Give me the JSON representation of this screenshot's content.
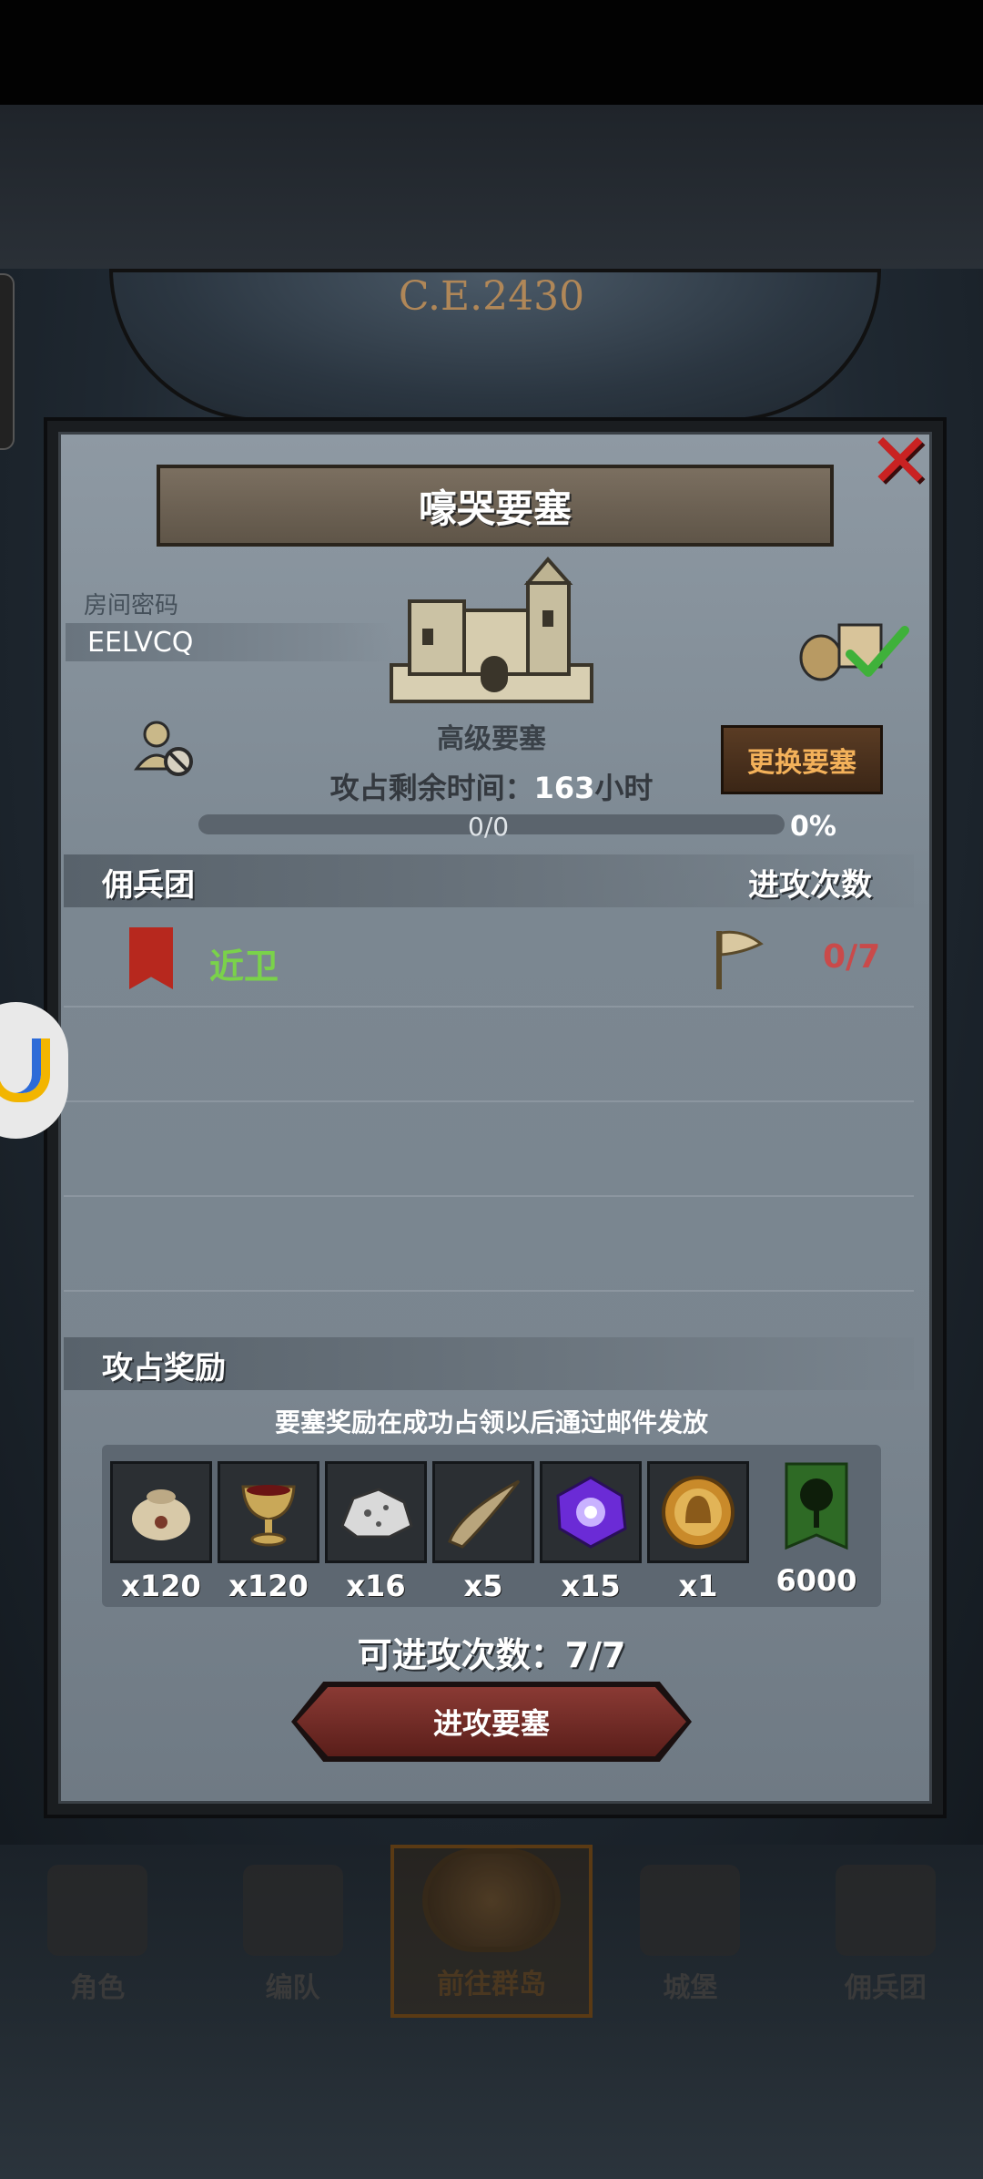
{
  "era": "C.E.2430",
  "popup": {
    "title": "嚎哭要塞",
    "close_icon": "close-x-icon",
    "room_code_label": "房间密码",
    "room_code": "EELVCQ",
    "fortress_type": "高级要塞",
    "change_button": "更换要塞",
    "time_left_label": "攻占剩余时间：",
    "time_left_value": "163",
    "time_left_unit": "小时",
    "progress_text": "0/0",
    "progress_percent_text": "0%",
    "progress_fraction": 0,
    "mercenary_header": "佣兵团",
    "attack_count_header": "进攻次数",
    "mercenaries": [
      {
        "name": "近卫",
        "attempts": "0/7",
        "name_color": "#7ad24a"
      }
    ],
    "rewards_header": "攻占奖励",
    "reward_note": "要塞奖励在成功占领以后通过邮件发放",
    "rewards": [
      {
        "icon": "sack-icon",
        "qty": "x120"
      },
      {
        "icon": "chalice-icon",
        "qty": "x120"
      },
      {
        "icon": "ore-icon",
        "qty": "x16"
      },
      {
        "icon": "horn-icon",
        "qty": "x5"
      },
      {
        "icon": "purple-crystal-icon",
        "qty": "x15"
      },
      {
        "icon": "gold-coin-icon",
        "qty": "x1"
      },
      {
        "icon": "tree-banner-icon",
        "qty": "6000"
      }
    ],
    "available_attacks_label": "可进攻次数：",
    "available_attacks_value": "7/7",
    "attack_button": "进攻要塞"
  },
  "bottom_nav": [
    {
      "label": "角色",
      "active": false
    },
    {
      "label": "编队",
      "active": false
    },
    {
      "label": "前往群岛",
      "active": true
    },
    {
      "label": "城堡",
      "active": false
    },
    {
      "label": "佣兵团",
      "active": false
    }
  ],
  "colors": {
    "accent_gold": "#f3b15a",
    "attempts_red": "#c94a4a",
    "close_red": "#c92222"
  }
}
